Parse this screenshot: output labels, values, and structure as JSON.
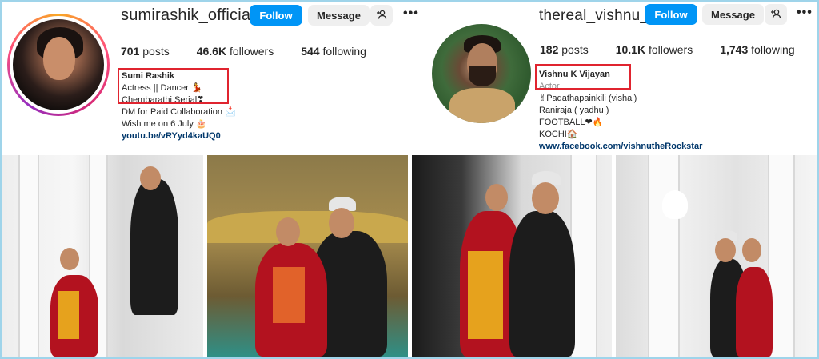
{
  "profiles": [
    {
      "username": "sumirashik_official_",
      "follow_label": "Follow",
      "message_label": "Message",
      "stats": {
        "posts": "701",
        "posts_label": "posts",
        "followers": "46.6K",
        "followers_label": "followers",
        "following": "544",
        "following_label": "following"
      },
      "bio": {
        "name": "Sumi Rashik",
        "line1": "Actress || Dancer 💃",
        "line2": "Chembarathi Serial❣",
        "line3": "DM for Paid Collaboration 📩",
        "line4": "Wish me on 6 July 🎂",
        "link": "youtu.be/vRYyd4kaUQ0"
      }
    },
    {
      "username": "thereal_vishnu_",
      "follow_label": "Follow",
      "message_label": "Message",
      "stats": {
        "posts": "182",
        "posts_label": "posts",
        "followers": "10.1K",
        "followers_label": "followers",
        "following": "1,743",
        "following_label": "following"
      },
      "bio": {
        "name": "Vishnu K Vijayan",
        "category": "Actor",
        "line1": "✌Padathapainkili (vishal)",
        "line2": "Raniraja ( yadhu )",
        "line3": "FOOTBALL❤🔥",
        "line4": "KOCHI🏠",
        "link": "www.facebook.com/vishnutheRockstar"
      }
    }
  ],
  "icons": {
    "add_user": "add-user-icon",
    "more": "more-options-icon"
  },
  "colors": {
    "follow_button": "#0095f6",
    "secondary_button": "#efefef",
    "highlight_box": "#e0242f",
    "link": "#00376b",
    "frame": "#9fd4ea"
  },
  "grid": {
    "posts": [
      "post-1",
      "post-2",
      "post-3",
      "post-4"
    ]
  }
}
